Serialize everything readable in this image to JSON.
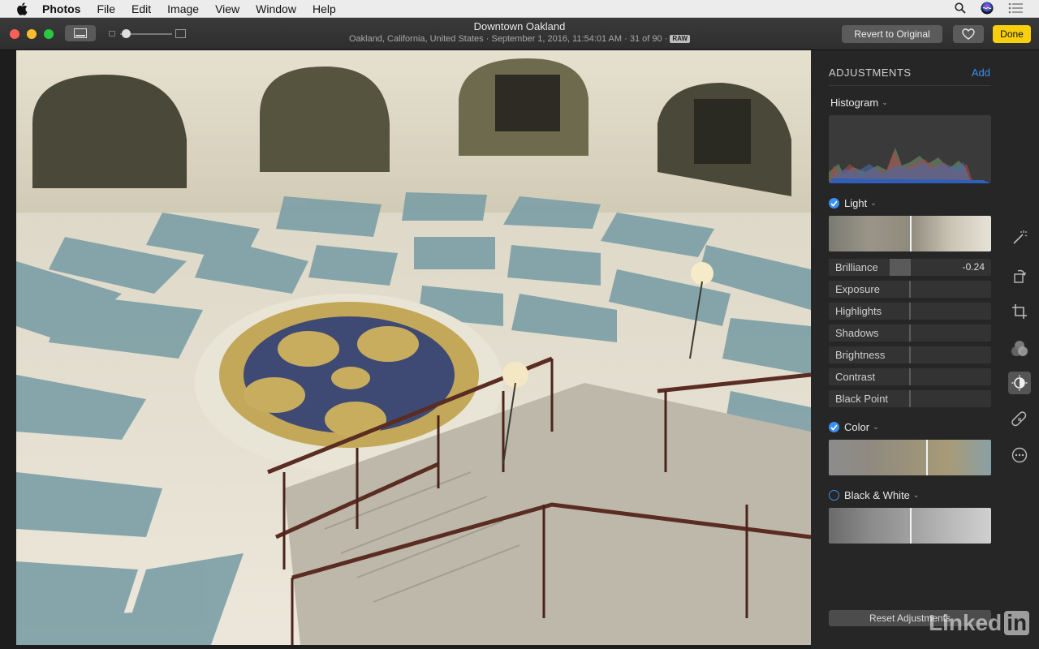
{
  "menubar": {
    "items": [
      "Photos",
      "File",
      "Edit",
      "Image",
      "View",
      "Window",
      "Help"
    ]
  },
  "toolbar": {
    "title": "Downtown Oakland",
    "subtitle": "Oakland, California, United States · September 1, 2016, 11:54:01 AM · 31 of 90 ·",
    "raw_badge": "RAW",
    "revert_label": "Revert to Original",
    "done_label": "Done"
  },
  "adjustments": {
    "header": "ADJUSTMENTS",
    "add_label": "Add",
    "histogram_label": "Histogram",
    "light": {
      "label": "Light",
      "enabled": true,
      "sliders": [
        {
          "label": "Brilliance",
          "value": "-0.24"
        },
        {
          "label": "Exposure",
          "value": ""
        },
        {
          "label": "Highlights",
          "value": ""
        },
        {
          "label": "Shadows",
          "value": ""
        },
        {
          "label": "Brightness",
          "value": ""
        },
        {
          "label": "Contrast",
          "value": ""
        },
        {
          "label": "Black Point",
          "value": ""
        }
      ]
    },
    "color": {
      "label": "Color",
      "enabled": true
    },
    "black_white": {
      "label": "Black & White",
      "enabled": false
    },
    "reset_label": "Reset Adjustments"
  },
  "tools": [
    "magic-wand-icon",
    "rotate-icon",
    "crop-icon",
    "filters-icon",
    "adjust-icon",
    "retouch-icon",
    "more-icon"
  ],
  "watermark": {
    "text": "Linked",
    "badge": "in"
  },
  "colors": {
    "accent": "#3b8ff0",
    "done": "#f7cf0d"
  }
}
